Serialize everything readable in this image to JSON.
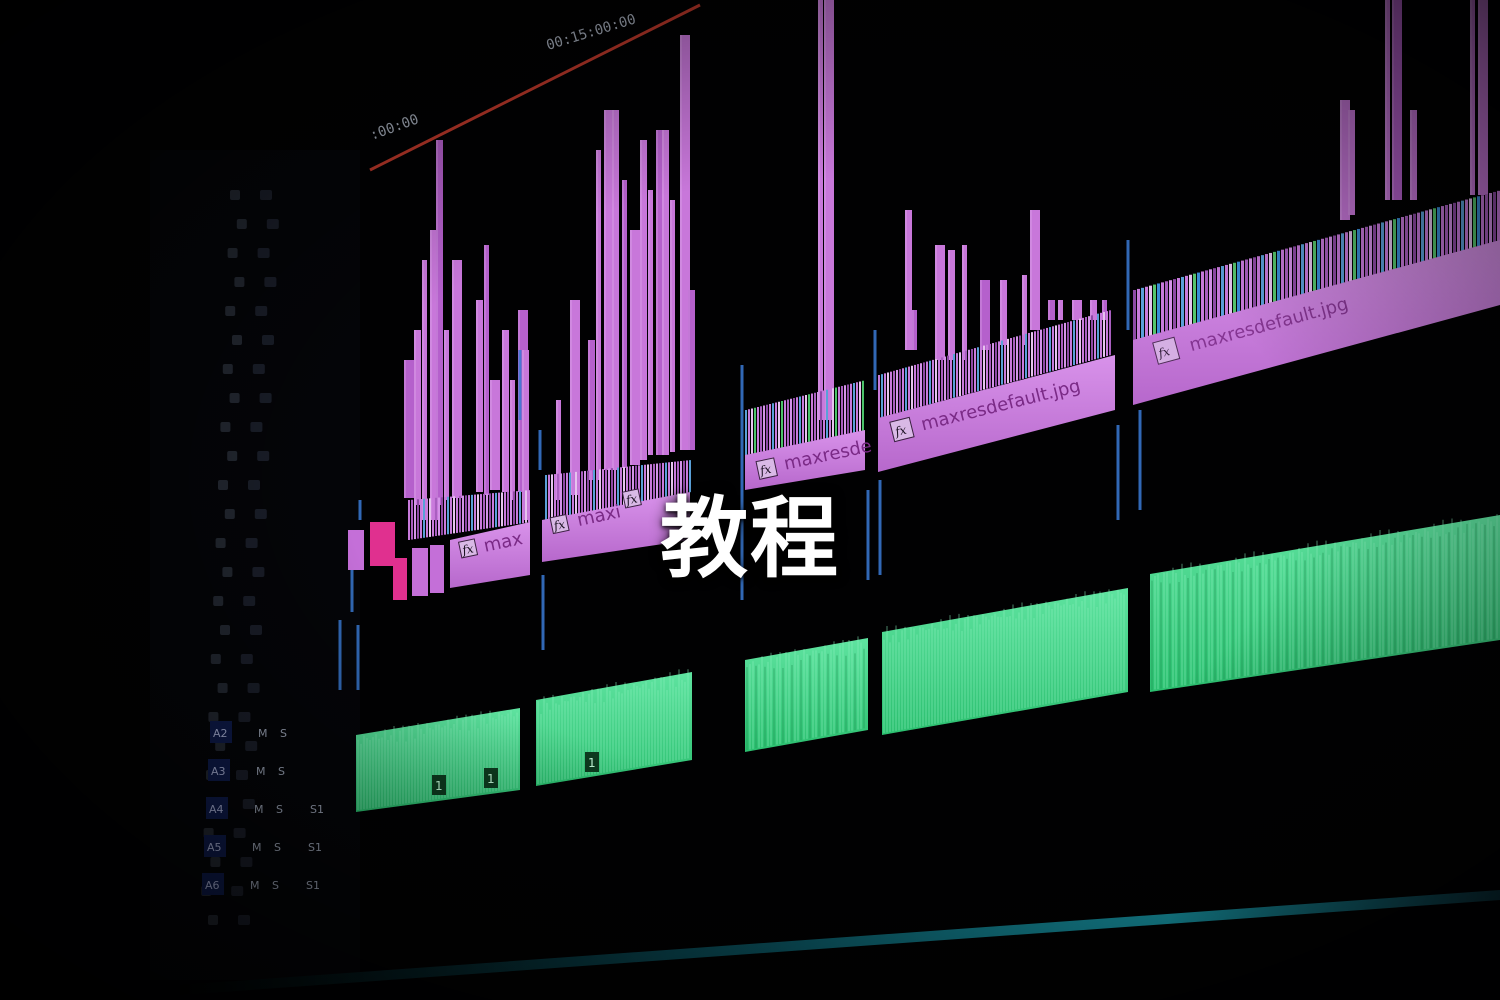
{
  "overlay": {
    "title": "教程"
  },
  "timeline": {
    "ruler_timecode": "00:15:00:00",
    "ruler_start": ":00:00",
    "video_clips": [
      {
        "label": "max"
      },
      {
        "label": "maxi"
      },
      {
        "label": "maxresde"
      },
      {
        "label": "maxresdefault.jpg"
      },
      {
        "label": "maxresdefault.jpg"
      }
    ],
    "audio_markers": [
      "1",
      "1",
      "1"
    ]
  },
  "track_header": {
    "tracks": [
      {
        "id": "A2",
        "m": "M",
        "s": "S"
      },
      {
        "id": "A3",
        "m": "M",
        "s": "S"
      },
      {
        "id": "A4",
        "m": "M",
        "s": "S",
        "extra": "S1"
      },
      {
        "id": "A5",
        "m": "M",
        "s": "S",
        "extra": "S1"
      },
      {
        "id": "A6",
        "m": "M",
        "s": "S",
        "extra": "S1"
      }
    ]
  },
  "colors": {
    "video_clip": "#c77ad9",
    "video_clip_bright": "#d58be6",
    "audio_clip": "#2fd27c",
    "audio_clip_light": "#6fe6a6",
    "playhead_line": "#c0392b",
    "accent_blue": "#3b6fd6",
    "bottom_glow": "#1aa6b7"
  }
}
